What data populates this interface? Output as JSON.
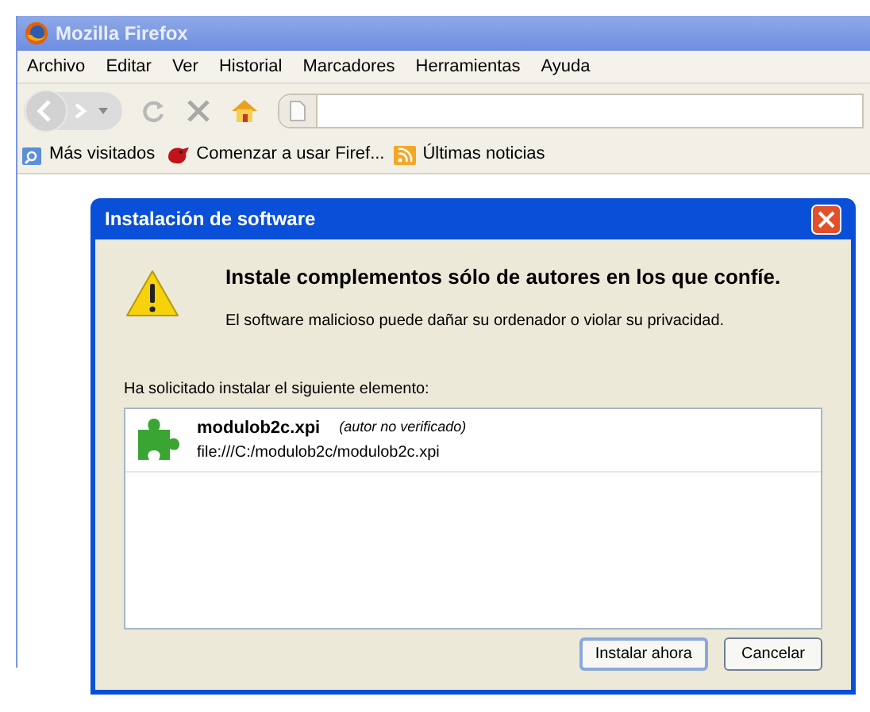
{
  "window": {
    "title": "Mozilla Firefox"
  },
  "menu": [
    "Archivo",
    "Editar",
    "Ver",
    "Historial",
    "Marcadores",
    "Herramientas",
    "Ayuda"
  ],
  "bookmarks": [
    {
      "kind": "smart",
      "label": "Más visitados"
    },
    {
      "kind": "firefox",
      "label": "Comenzar a usar Firef..."
    },
    {
      "kind": "feed",
      "label": "Últimas noticias"
    }
  ],
  "dialog": {
    "title": "Instalación de software",
    "heading": "Instale complementos sólo de autores en los que confíe.",
    "message": "El software malicioso puede dañar su ordenador o violar su privacidad.",
    "list_label": "Ha solicitado instalar el siguiente elemento:",
    "items": [
      {
        "name": "modulob2c.xpi",
        "author": "(autor no verificado)",
        "url": "file:///C:/modulob2c/modulob2c.xpi"
      }
    ],
    "buttons": [
      {
        "label": "Instalar ahora",
        "default": true
      },
      {
        "label": "Cancelar",
        "default": false
      }
    ]
  }
}
